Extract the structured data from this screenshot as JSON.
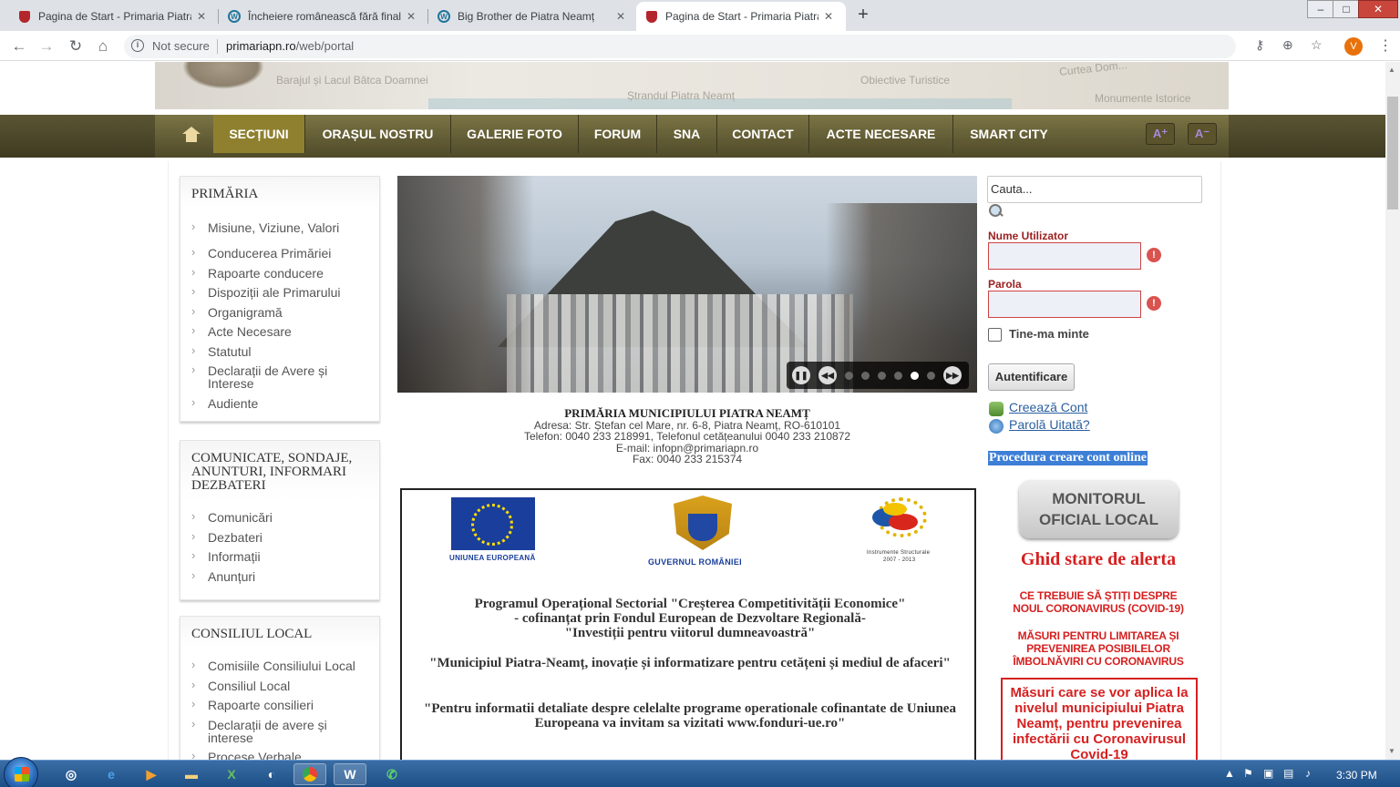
{
  "browser": {
    "tabs": [
      {
        "title": "Pagina de Start - Primaria Piatra N",
        "favicon": "shield-icon",
        "active": false
      },
      {
        "title": "Încheiere românească fără final f",
        "favicon": "wordpress-icon",
        "active": false
      },
      {
        "title": "Big Brother de Piatra Neamț",
        "favicon": "wordpress-icon",
        "active": false
      },
      {
        "title": "Pagina de Start - Primaria Piatra N",
        "favicon": "shield-icon",
        "active": true
      }
    ],
    "security_label": "Not secure",
    "url_host": "primariapn.ro",
    "url_path": "/web/portal",
    "profile_initial": "V"
  },
  "banner": {
    "captions": [
      "Barajul și Lacul Bâtca Doamnei",
      "Ștrandul Piatra Neamț",
      "Obiective Turistice",
      "Curtea Dom...",
      "Monumente Istorice"
    ]
  },
  "nav": {
    "items": [
      "SECȚIUNI",
      "ORAȘUL NOSTRU",
      "GALERIE FOTO",
      "FORUM",
      "SNA",
      "CONTACT",
      "ACTE NECESARE",
      "SMART CITY"
    ],
    "active_index": 0,
    "font_plus": "A⁺",
    "font_minus": "A⁻"
  },
  "sidebar": {
    "primaria": {
      "title": "PRIMĂRIA",
      "items": [
        "Misiune, Viziune, Valori",
        "Conducerea Primăriei",
        "Rapoarte conducere",
        "Dispoziții ale Primarului",
        "Organigramă",
        "Acte Necesare",
        "Statutul",
        "Declarații de Avere și Interese",
        "Audiente"
      ]
    },
    "comunicate": {
      "title": "COMUNICATE, SONDAJE, ANUNTURI, INFORMARI DEZBATERI",
      "items": [
        "Comunicări",
        "Dezbateri",
        "Informații",
        "Anunțuri"
      ]
    },
    "consiliu": {
      "title": "CONSILIUL LOCAL",
      "items": [
        "Comisiile Consiliului Local",
        "Consiliul Local",
        "Rapoarte consilieri",
        "Declarații de avere și interese",
        "Procese Verbale"
      ]
    }
  },
  "slider": {
    "total_slides": 6,
    "current_slide": 5
  },
  "contact": {
    "title": "PRIMĂRIA MUNICIPIULUI PIATRA NEAMȚ",
    "address": "Adresa: Str. Ștefan cel Mare, nr. 6-8, Piatra Neamț, RO-610101",
    "phone": "Telefon: 0040 233 218991, Telefonul cetățeanului 0040 233 210872",
    "email": "E-mail: infopn@primariapn.ro",
    "fax": "Fax: 0040 233 215374"
  },
  "eu_project": {
    "logo_eu": "UNIUNEA EUROPEANĂ",
    "logo_gov": "GUVERNUL ROMÂNIEI",
    "logo_is_1": "Instrumente Structurale",
    "logo_is_2": "2007 - 2013",
    "line1": "Programul Operațional Sectorial \"Creșterea Competitivității Economice\"",
    "line2": "- cofinanțat prin Fondul European de Dezvoltare Regională-",
    "line3": "\"Investiții pentru viitorul dumneavoastră\"",
    "line4": "\"Municipiul Piatra-Neamț, inovație și informatizare pentru cetățeni și mediul de afaceri\"",
    "line5": "\"Pentru informatii detaliate despre celelalte programe operationale cofinantate de Uniunea Europeana va invitam sa vizitati www.fonduri-ue.ro\""
  },
  "login": {
    "search_value": "Cauta...",
    "username_label": "Nume Utilizator",
    "password_label": "Parola",
    "remember_label": "Tine-ma minte",
    "submit_label": "Autentificare",
    "create_account": "Creează Cont",
    "forgot_password": "Parolă Uitată?",
    "procedure_link": "Procedura creare cont online"
  },
  "right_col": {
    "monitor_line1": "MONITORUL",
    "monitor_line2": "OFICIAL LOCAL",
    "ghid_title": "Ghid stare de alerta",
    "covid_1a": "CE TREBUIE SĂ ȘTIȚI DESPRE",
    "covid_1b": "NOUL CORONAVIRUS (COVID-19)",
    "covid_2a": "MĂSURI  PENTRU LIMITAREA ȘI",
    "covid_2b": "PREVENIREA POSIBILELOR",
    "covid_2c": "ÎMBOLNĂVIRI CU CORONAVIRUS",
    "box_text": "Măsuri care se vor aplica la nivelul municipiului Piatra Neamț, pentru prevenirea infectării cu Coronavirusul Covid-19"
  },
  "taskbar": {
    "clock": "3:30 PM"
  },
  "colors": {
    "nav_bg": "#5a5533",
    "nav_active": "#8f8030",
    "alert_red": "#d62020",
    "link_blue": "#2a5f9e"
  }
}
